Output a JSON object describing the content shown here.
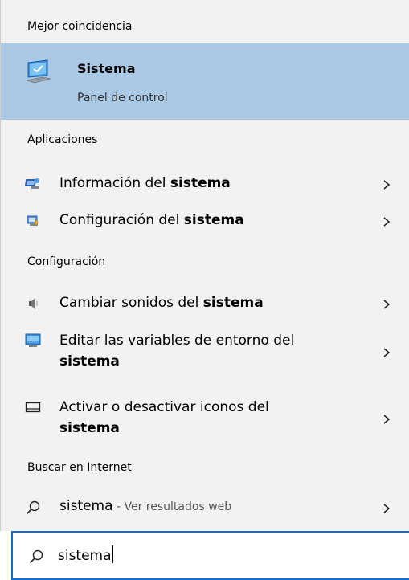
{
  "sections": {
    "best_match": "Mejor coincidencia",
    "apps": "Aplicaciones",
    "settings": "Configuración",
    "web": "Buscar en Internet"
  },
  "best_match": {
    "title": "Sistema",
    "subtitle": "Panel de control",
    "icon": "computer-monitor-icon"
  },
  "apps": [
    {
      "prefix": "Información del ",
      "bold": "sistema",
      "icon": "system-information-icon"
    },
    {
      "prefix": "Configuración del ",
      "bold": "sistema",
      "icon": "system-configuration-icon"
    }
  ],
  "settings": [
    {
      "prefix": "Cambiar sonidos del ",
      "bold": "sistema",
      "icon": "speaker-icon"
    },
    {
      "line1": "Editar las variables de entorno del",
      "bold": "sistema",
      "icon": "monitor-icon"
    },
    {
      "line1": "Activar o desactivar iconos del",
      "bold": "sistema",
      "icon": "taskbar-icon"
    }
  ],
  "web": {
    "query": "sistema",
    "suffix": " - Ver resultados web",
    "icon": "search-icon"
  },
  "search": {
    "value": "sistema",
    "icon": "search-icon"
  },
  "colors": {
    "panel_bg": "#f2f2f2",
    "selected_bg": "#aac9e4",
    "search_border": "#1170cf"
  }
}
